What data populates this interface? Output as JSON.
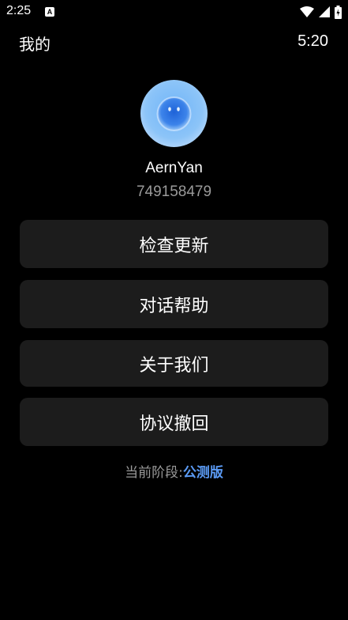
{
  "status_bar": {
    "time": "2:25",
    "app_icon_letter": "A",
    "icons": [
      "wifi-icon",
      "signal-icon",
      "battery-icon"
    ]
  },
  "header": {
    "title": "我的",
    "time": "5:20"
  },
  "profile": {
    "username": "AernYan",
    "user_id": "749158479"
  },
  "menu": {
    "items": [
      {
        "label": "检查更新"
      },
      {
        "label": "对话帮助"
      },
      {
        "label": "关于我们"
      },
      {
        "label": "协议撤回"
      }
    ]
  },
  "footer": {
    "stage_label": "当前阶段:",
    "stage_value": "公测版"
  },
  "colors": {
    "background": "#000000",
    "button_bg": "#1c1c1c",
    "secondary_text": "#9a9a9a",
    "accent": "#5b9bf5"
  }
}
